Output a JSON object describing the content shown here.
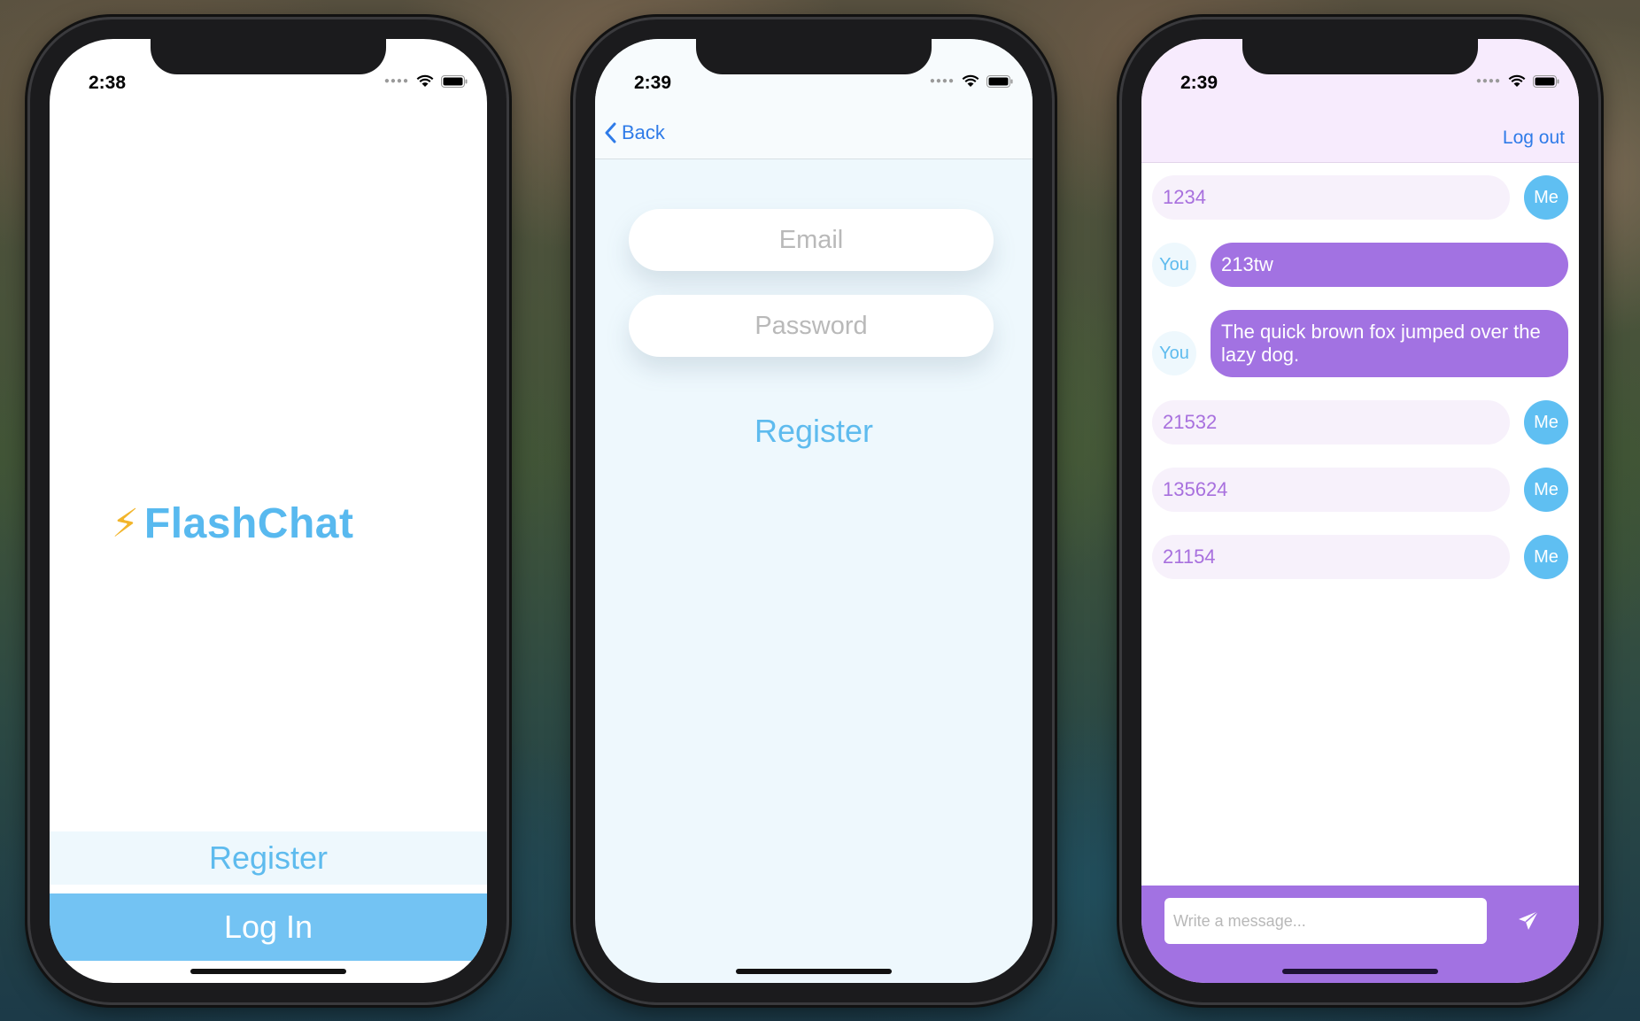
{
  "phones": [
    {
      "status_time": "2:38",
      "logo_bolt": "⚡",
      "logo_text": "FlashChat",
      "register_label": "Register",
      "login_label": "Log In"
    },
    {
      "status_time": "2:39",
      "back_label": "Back",
      "email_placeholder": "Email",
      "password_placeholder": "Password",
      "register_label": "Register"
    },
    {
      "status_time": "2:39",
      "logout_label": "Log out",
      "messages": [
        {
          "sender": "me",
          "avatar": "Me",
          "text": "1234"
        },
        {
          "sender": "you",
          "avatar": "You",
          "text": "213tw"
        },
        {
          "sender": "you",
          "avatar": "You",
          "text": "The quick brown fox jumped over the lazy dog."
        },
        {
          "sender": "me",
          "avatar": "Me",
          "text": "21532"
        },
        {
          "sender": "me",
          "avatar": "Me",
          "text": "135624"
        },
        {
          "sender": "me",
          "avatar": "Me",
          "text": "21154"
        }
      ],
      "composer_placeholder": "Write a message..."
    }
  ],
  "colors": {
    "brand_blue": "#58b9ef",
    "light_blue": "#eef8fd",
    "login_blue": "#73c3f3",
    "purple": "#a272e2",
    "purple_text": "#a870de",
    "link_blue": "#2f7be8"
  }
}
